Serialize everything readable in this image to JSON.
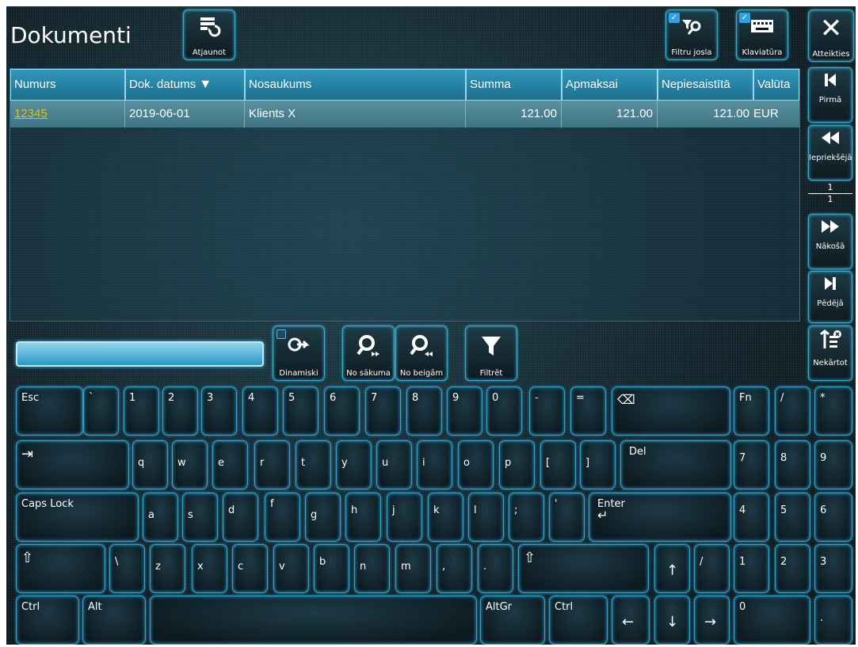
{
  "header": {
    "title": "Dokumenti",
    "refresh_label": "Atjaunot",
    "filter_bar_label": "Filtru josla",
    "keyboard_label": "Klaviatūra",
    "cancel_label": "Atteikties"
  },
  "table": {
    "columns": [
      "Numurs",
      "Dok. datums",
      "Nosaukums",
      "Summa",
      "Apmaksai",
      "Nepiesaistītā",
      "Valūta"
    ],
    "rows": [
      {
        "numurs": "12345",
        "datums": "2019-06-01",
        "nosaukums": "Klients X",
        "summa": "121.00",
        "apmaksai": "121.00",
        "nepiesaistita": "121.00",
        "valuta": "EUR"
      }
    ]
  },
  "nav": {
    "first_label": "Pirmā",
    "prev_label": "Iepriekšējā",
    "next_label": "Nākošā",
    "last_label": "Pēdējā",
    "page_current": "1",
    "page_total": "1",
    "unsort_label": "Nekārtot"
  },
  "filterbar": {
    "search_value": "",
    "dynamic_label": "Dinamiski",
    "from_start_label": "No sākuma",
    "from_end_label": "No beigām",
    "filter_label": "Filtrēt"
  },
  "keyboard": {
    "row1": [
      "Esc",
      "`",
      "1",
      "2",
      "3",
      "4",
      "5",
      "6",
      "7",
      "8",
      "9",
      "0",
      "-",
      "=",
      "⌫",
      "Fn",
      "/",
      "*"
    ],
    "row2": [
      "⇥",
      "q",
      "w",
      "e",
      "r",
      "t",
      "y",
      "u",
      "i",
      "o",
      "p",
      "[",
      "]",
      "Del",
      "7",
      "8",
      "9"
    ],
    "row3": [
      "Caps Lock",
      "a",
      "s",
      "d",
      "f",
      "g",
      "h",
      "j",
      "k",
      "l",
      ";",
      "'",
      "Enter",
      "4",
      "5",
      "6"
    ],
    "row4": [
      "⇧",
      "\\",
      "z",
      "x",
      "c",
      "v",
      "b",
      "n",
      "m",
      ",",
      ".",
      "⇧",
      "↑",
      "/",
      "1",
      "2",
      "3"
    ],
    "row5": [
      "Ctrl",
      "Alt",
      "",
      "AltGr",
      "Ctrl",
      "←",
      "↓",
      "→",
      "0",
      "."
    ]
  },
  "colors": {
    "accent": "#2a9fd0",
    "header_bg": "#3196bb",
    "selected_row": "#4f8694",
    "link": "#d9c21c"
  }
}
